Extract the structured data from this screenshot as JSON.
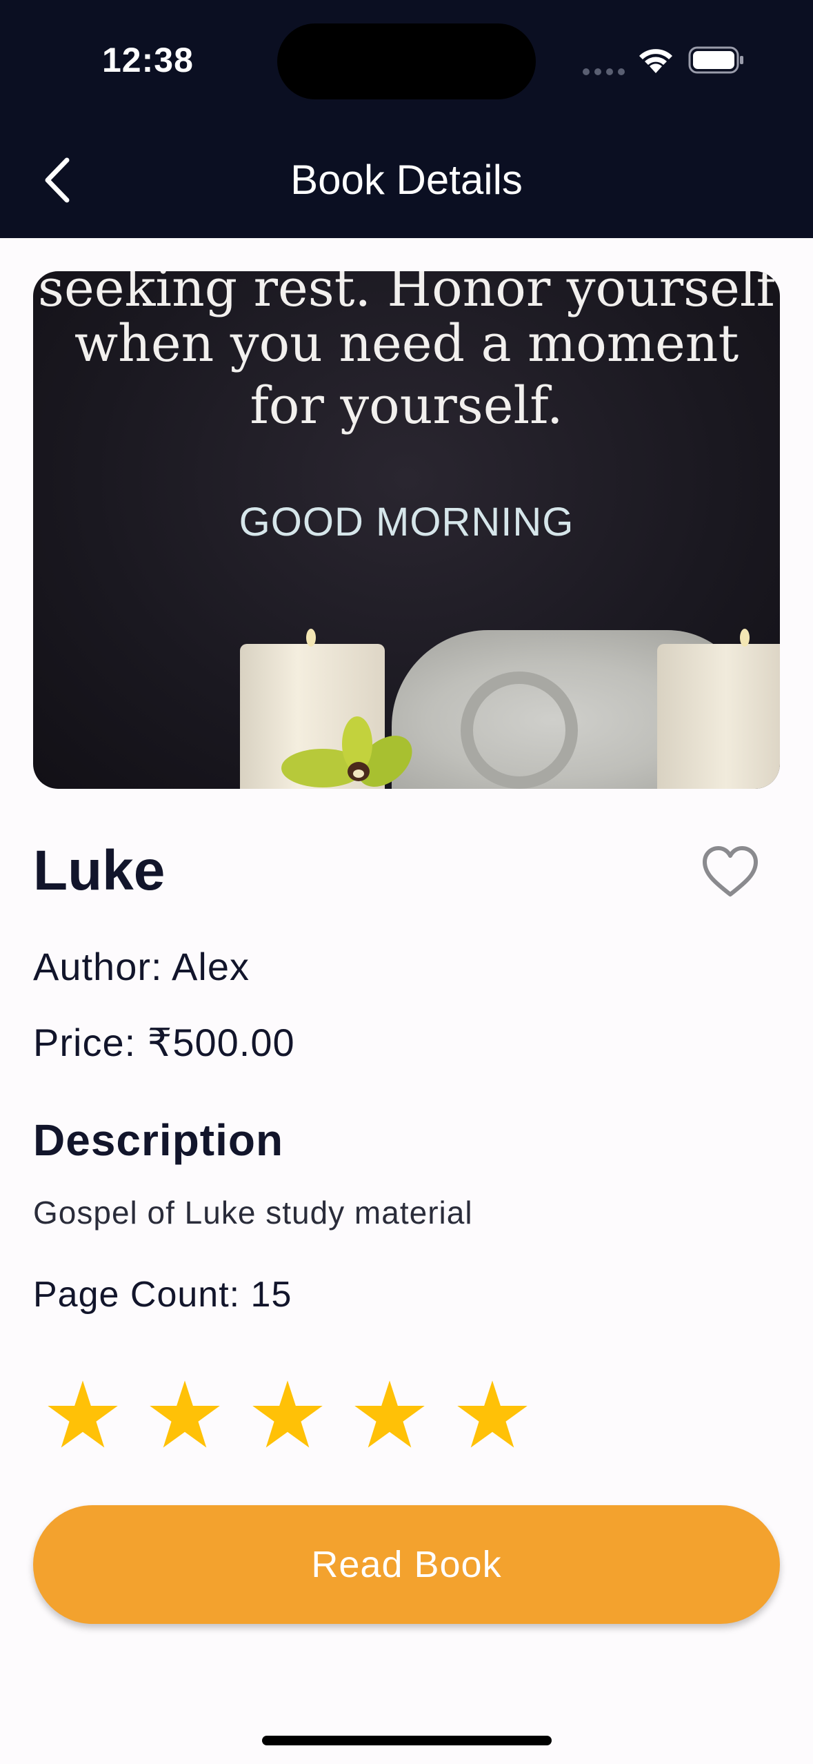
{
  "status_bar": {
    "time": "12:38"
  },
  "header": {
    "title": "Book Details"
  },
  "cover": {
    "line1": "seeking rest. Honor yourself",
    "line2": "when you need a moment",
    "line3": "for yourself.",
    "greeting": "GOOD MORNING"
  },
  "book": {
    "title": "Luke",
    "author": "Author: Alex",
    "price": "Price: ₹500.00",
    "description_heading": "Description",
    "description": "Gospel of Luke study material",
    "page_count": "Page Count: 15",
    "rating": 5,
    "rating_max": 5
  },
  "actions": {
    "read_label": "Read Book"
  },
  "colors": {
    "header_bg": "#0b0f22",
    "accent": "#f3a22e",
    "star": "#ffc107",
    "text": "#12152b"
  }
}
